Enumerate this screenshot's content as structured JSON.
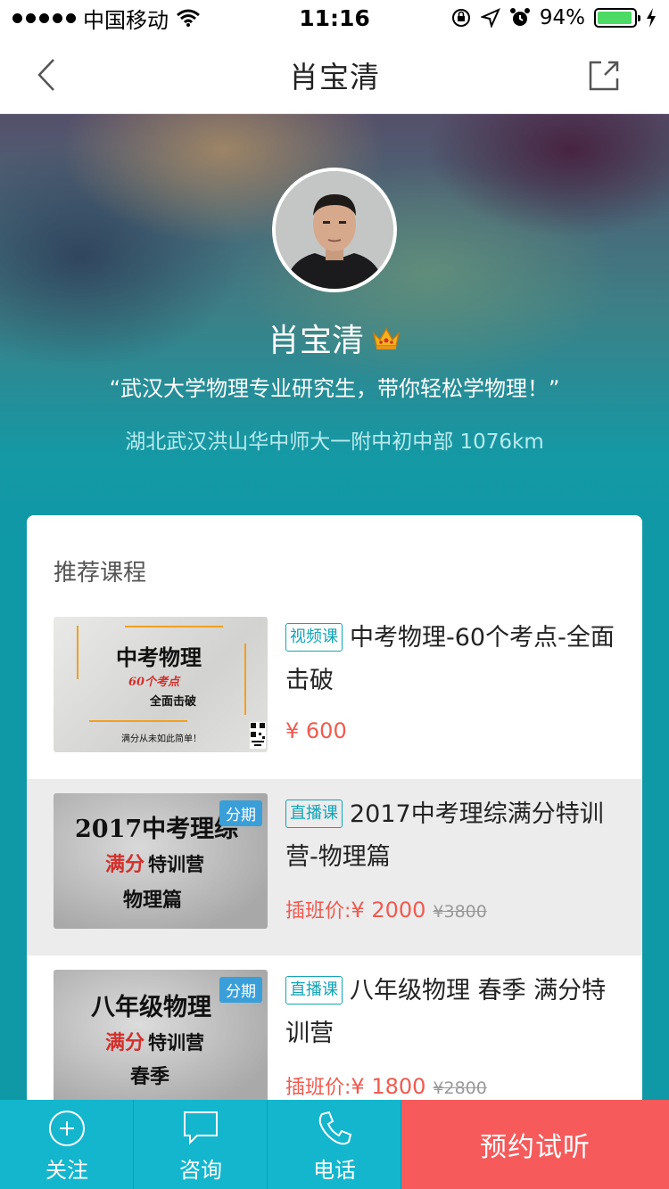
{
  "status_bar": {
    "carrier": "中国移动",
    "time": "11:16",
    "battery": "94%",
    "battery_level": 0.94
  },
  "nav": {
    "title": "肖宝清",
    "back_icon": "chevron-left-icon",
    "share_icon": "share-icon"
  },
  "profile": {
    "name": "肖宝清",
    "motto": "“武汉大学物理专业研究生，带你轻松学物理！”",
    "location": "湖北武汉洪山华中师大一附中初中部 1076km",
    "badge_icon": "crown-icon"
  },
  "courses": {
    "section_title": "推荐课程",
    "items": [
      {
        "tag": "视频课",
        "title": "中考物理-60个考点-全面击破",
        "price": "¥ 600",
        "price_label": "",
        "old_price": "",
        "thumb_lines": [
          "中考物理",
          "60个考点",
          "全面击破",
          "满分从未如此简单！"
        ],
        "thumb_badge": ""
      },
      {
        "tag": "直播课",
        "title": "2017中考理综满分特训营-物理篇",
        "price_label": "插班价:",
        "price": "¥  2000",
        "old_price": "¥3800",
        "thumb_lines": [
          "2017中考理综",
          "满分",
          "特训营",
          "物理篇"
        ],
        "thumb_badge": "分期"
      },
      {
        "tag": "直播课",
        "title": "八年级物理 春季 满分特训营",
        "price_label": "插班价:",
        "price": "¥  1800",
        "old_price": "¥2800",
        "thumb_lines": [
          "八年级物理",
          "满分",
          "特训营",
          "春季"
        ],
        "thumb_badge": "分期"
      }
    ]
  },
  "bottom_bar": {
    "follow": "关注",
    "consult": "咨询",
    "phone": "电话",
    "cta": "预约试听"
  },
  "colors": {
    "accent": "#13b6cd",
    "cta": "#f65a5a",
    "price": "#f05a4f",
    "tag": "#12a4b6"
  }
}
